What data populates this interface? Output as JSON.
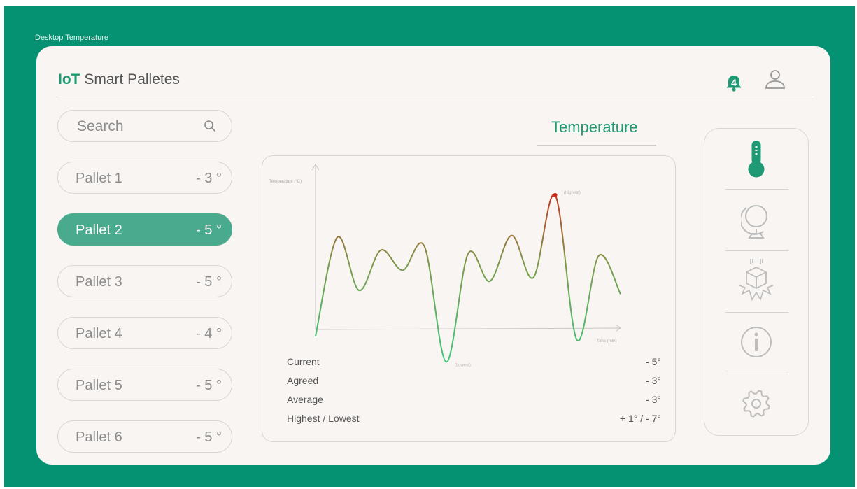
{
  "window": {
    "label": "Desktop Temperature"
  },
  "header": {
    "brand_bold": "IoT",
    "brand_rest": "Smart Palletes",
    "notification_count": "4"
  },
  "search": {
    "placeholder": "Search"
  },
  "pallets": [
    {
      "name": "Pallet 1",
      "value": "- 3 °"
    },
    {
      "name": "Pallet 2",
      "value": "- 5 °",
      "active": true
    },
    {
      "name": "Pallet 3",
      "value": "- 5 °"
    },
    {
      "name": "Pallet 4",
      "value": "- 4 °"
    },
    {
      "name": "Pallet 5",
      "value": "- 5 °"
    },
    {
      "name": "Pallet 6",
      "value": "- 5 °"
    }
  ],
  "main": {
    "title": "Temperature"
  },
  "chart_data": {
    "type": "line",
    "ylabel": "Temperature (°C)",
    "xlabel": "Time (min)",
    "annotations": {
      "highest": "(Highest)",
      "lowest": "(Lowest)"
    },
    "series": [
      {
        "y": [
          -7.0,
          -1.6,
          -4.5,
          -2.3,
          -3.4,
          -2.1,
          -8.4,
          -2.5,
          -4.0,
          -1.5,
          -3.8,
          0.7,
          -7.2,
          -2.6,
          -4.7
        ]
      }
    ],
    "highest": 1,
    "lowest": -7,
    "colors": {
      "low": "#39c97d",
      "high": "#cf2a1e"
    }
  },
  "stats": [
    {
      "label": "Current",
      "value": "- 5°"
    },
    {
      "label": "Agreed",
      "value": "- 3°"
    },
    {
      "label": "Average",
      "value": "- 3°"
    },
    {
      "label": "Highest / Lowest",
      "value": "+ 1° / - 7°"
    }
  ],
  "rail": {
    "items": [
      {
        "icon": "thermometer-icon",
        "active": true
      },
      {
        "icon": "globe-icon"
      },
      {
        "icon": "fragile-box-icon"
      },
      {
        "icon": "info-icon"
      },
      {
        "icon": "gear-icon"
      }
    ]
  },
  "colors": {
    "brand": "#049273",
    "accent": "#1f9a74",
    "active_pill": "#4aaa8d"
  }
}
